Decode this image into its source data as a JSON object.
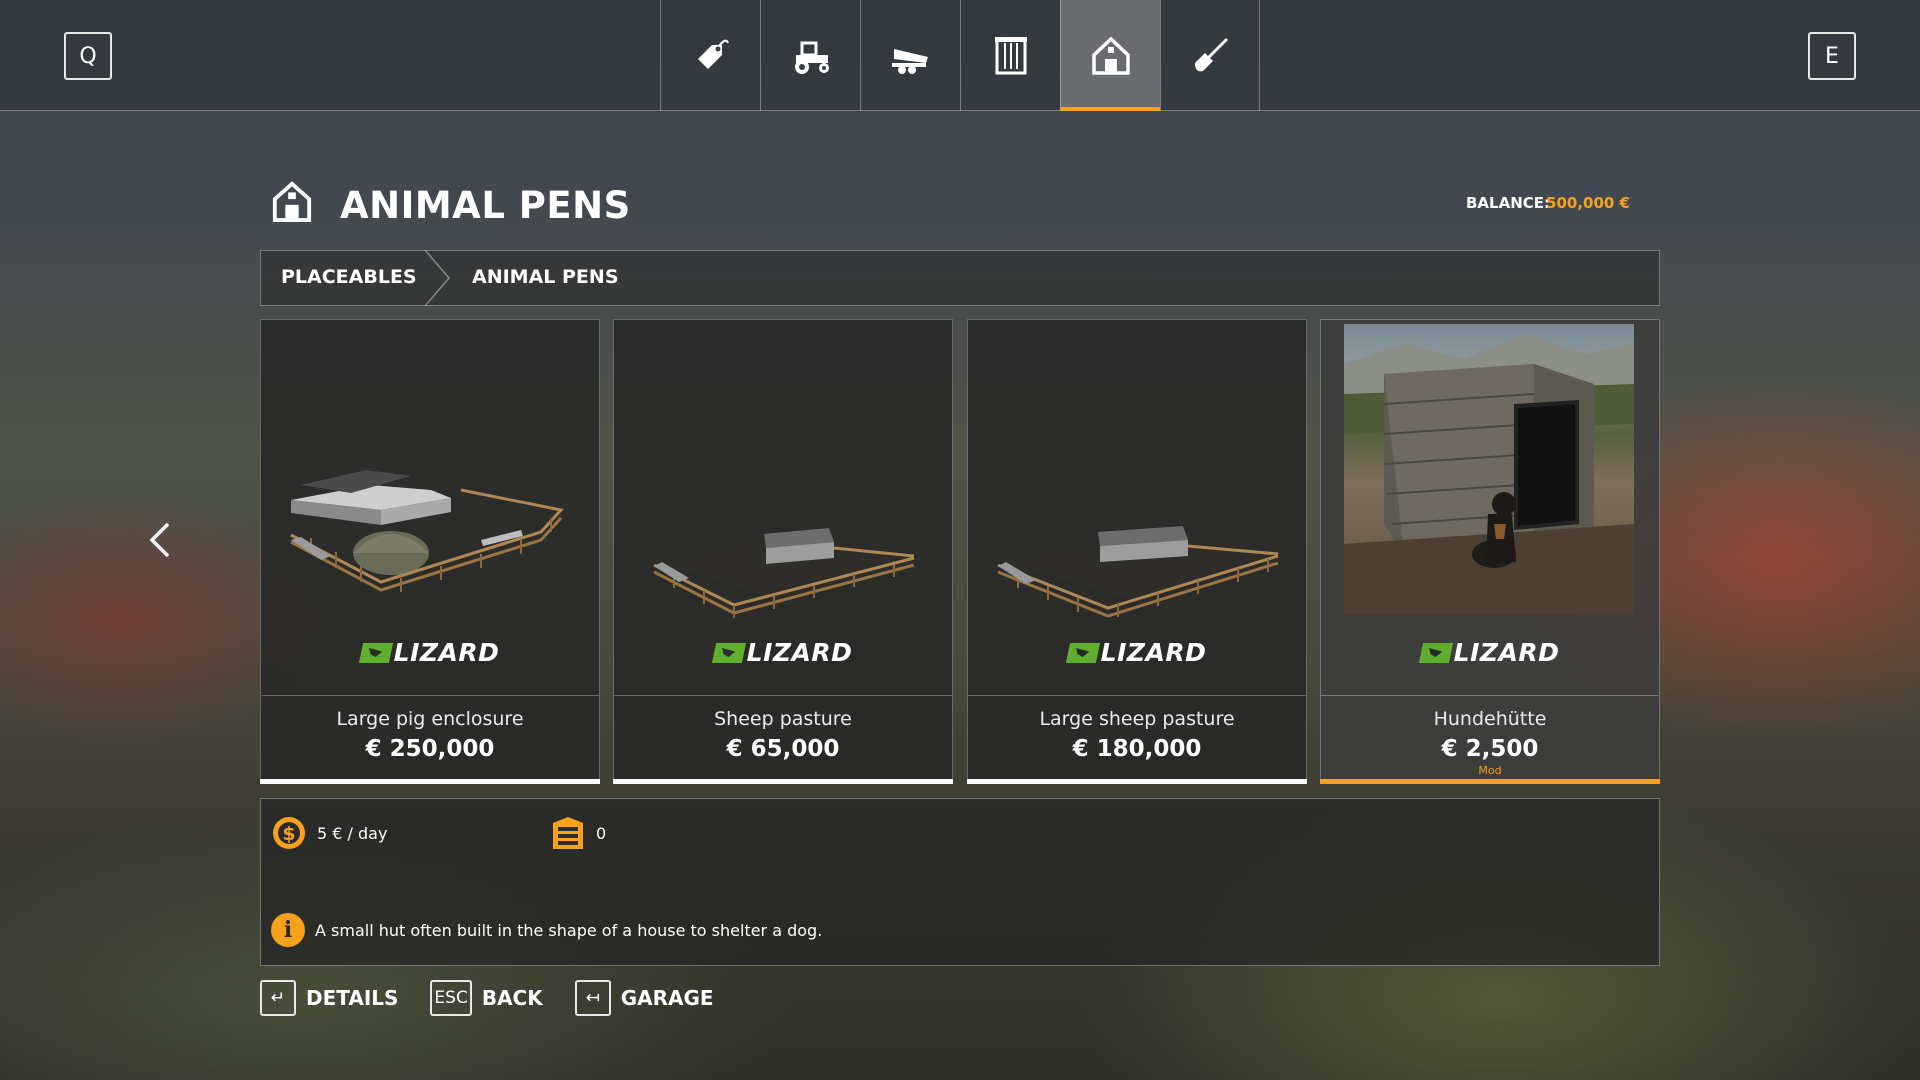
{
  "topbar": {
    "left_key": "Q",
    "right_key": "E",
    "tabs": [
      {
        "icon": "price-tag-icon"
      },
      {
        "icon": "tractor-icon"
      },
      {
        "icon": "trailer-icon"
      },
      {
        "icon": "silo-icon"
      },
      {
        "icon": "barn-icon",
        "active": true
      },
      {
        "icon": "shovel-icon"
      }
    ]
  },
  "header": {
    "title": "ANIMAL PENS",
    "balance_label": "BALANCE:",
    "balance_value": "500,000 €"
  },
  "breadcrumb": [
    "PLACEABLES",
    "ANIMAL PENS"
  ],
  "cards": [
    {
      "name": "Large pig enclosure",
      "price": "€ 250,000",
      "brand": "LIZARD",
      "mod": ""
    },
    {
      "name": "Sheep pasture",
      "price": "€ 65,000",
      "brand": "LIZARD",
      "mod": ""
    },
    {
      "name": "Large sheep pasture",
      "price": "€ 180,000",
      "brand": "LIZARD",
      "mod": ""
    },
    {
      "name": "Hundehütte",
      "price": "€ 2,500",
      "brand": "LIZARD",
      "mod": "Mod",
      "selected": true
    }
  ],
  "details": {
    "upkeep": "5 € / day",
    "capacity": "0",
    "description": "A small hut often built in the shape of a house to shelter a dog."
  },
  "footer": {
    "details_key": "↵",
    "details_label": "DETAILS",
    "back_key": "ESC",
    "back_label": "BACK",
    "garage_key": "↤",
    "garage_label": "GARAGE"
  },
  "colors": {
    "accent": "#f7a21a",
    "brand_green": "#5fae2e"
  }
}
